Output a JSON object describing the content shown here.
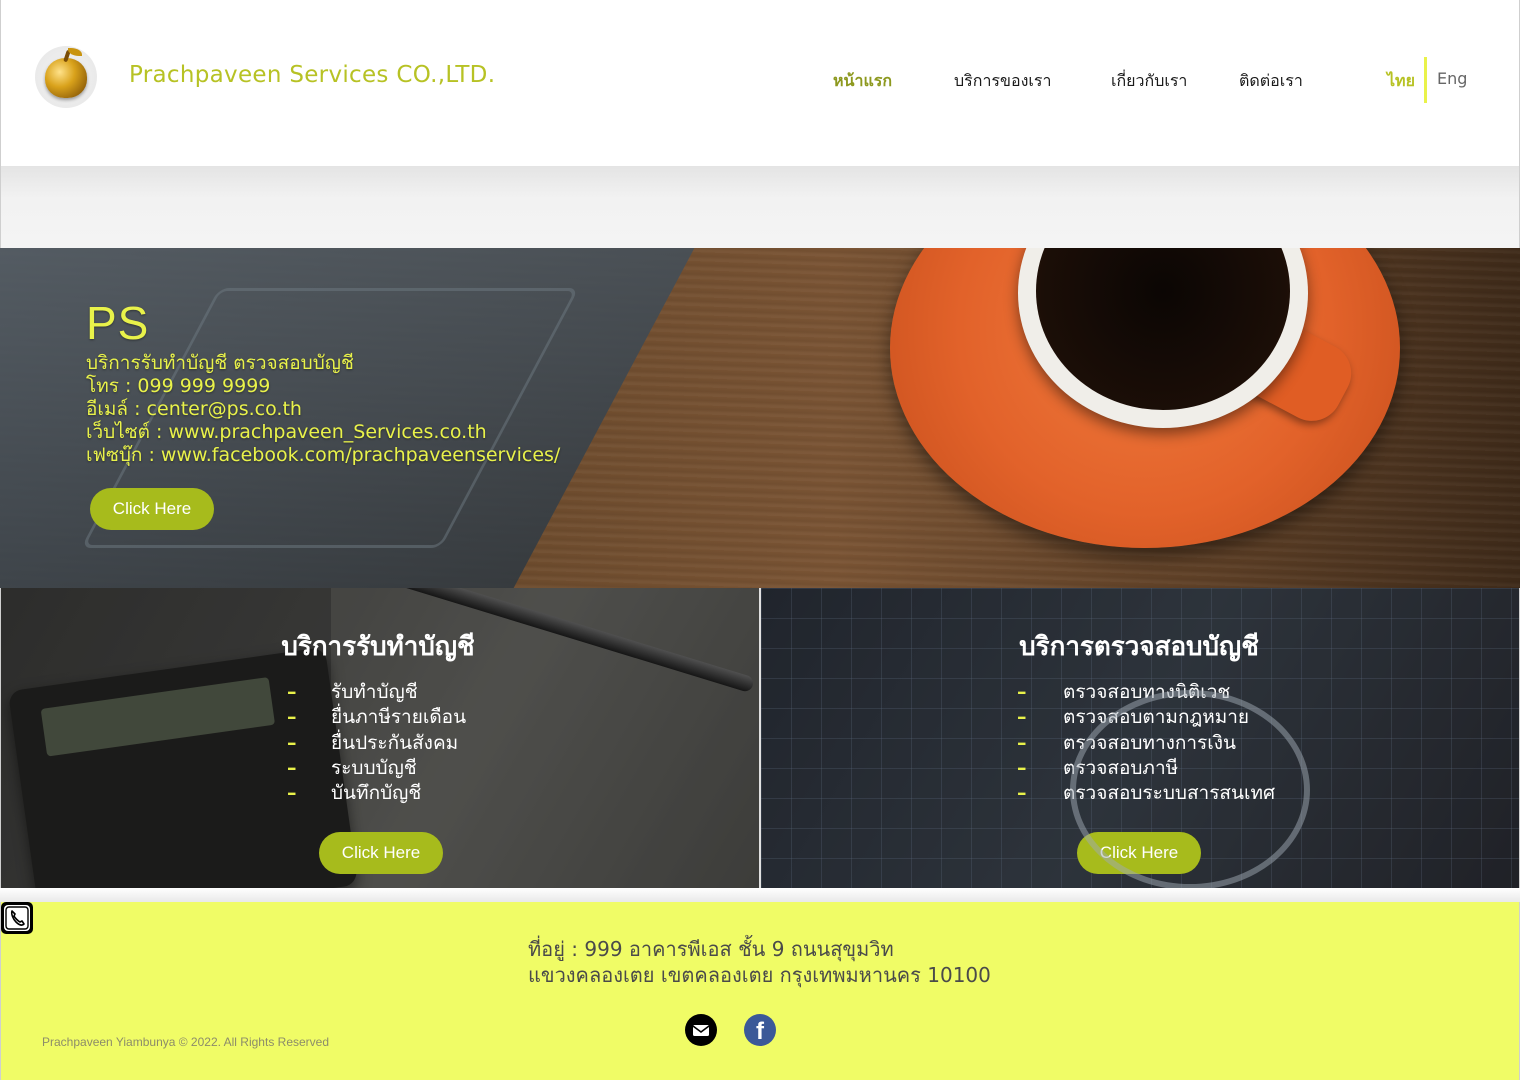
{
  "header": {
    "brand": "Prachpaveen Services CO.,LTD.",
    "nav": [
      "หน้าแรก",
      "บริการของเรา",
      "เกี่ยวกับเรา",
      "ติดต่อเรา"
    ],
    "lang_th": "ไทย",
    "lang_en": "Eng"
  },
  "hero": {
    "title": "PS",
    "lines": [
      "บริการรับทำบัญชี  ตรวจสอบบัญชี",
      "โทร : 099 999 9999",
      "อีเมล์ : center@ps.co.th",
      "เว็บไซต์ : www.prachpaveen_Services.co.th",
      "เฟซบุ๊ก : www.facebook.com/prachpaveenservices/"
    ],
    "button": "Click Here"
  },
  "services": [
    {
      "title": "บริการรับทำบัญชี",
      "items": [
        "รับทำบัญชี",
        "ยื่นภาษีรายเดือน",
        "ยื่นประกันสังคม",
        "ระบบบัญชี",
        "บันทึกบัญชี"
      ],
      "button": "Click Here"
    },
    {
      "title": "บริการตรวจสอบบัญชี",
      "items": [
        "ตรวจสอบทางนิติเวช",
        "ตรวจสอบตามกฎหมาย",
        "ตรวจสอบทางการเงิน",
        "ตรวจสอบภาษี",
        "ตรวจสอบระบบสารสนเทศ"
      ],
      "button": "Click Here"
    }
  ],
  "footer": {
    "address_line1": "ที่อยู่ : 999 อาคารพีเอส ชั้น 9 ถนนสุขุมวิท",
    "address_line2": "แขวงคลองเตย เขตคลองเตย กรุงเทพมหานคร 10100",
    "copyright": "Prachpaveen Yiambunya © 2022. All Rights Reserved",
    "icons": [
      "mail-icon",
      "facebook-icon",
      "phone-icon"
    ],
    "fb_glyph": "f"
  },
  "colors": {
    "accent": "#e9f24a",
    "brand": "#b7c224",
    "button": "#a7bb1c",
    "footer_bg": "#f0fc66"
  }
}
